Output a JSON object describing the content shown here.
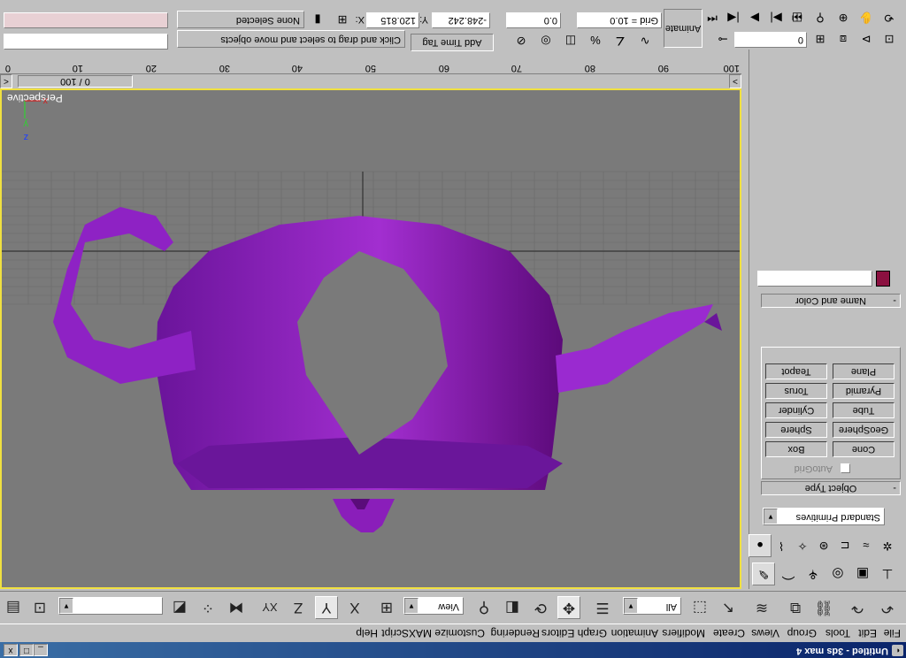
{
  "window": {
    "title": "Untitled - 3ds max 4",
    "minimize": "_",
    "maximize": "□",
    "close": "x"
  },
  "menus": [
    "File",
    "Edit",
    "Tools",
    "Group",
    "Views",
    "Create",
    "Modifiers",
    "Animation",
    "Graph Editors",
    "Rendering",
    "Customize",
    "MAXScript",
    "Help"
  ],
  "toolbar": {
    "selection_filter": "All",
    "ref_coord": "View",
    "axis_x": "X",
    "axis_y": "Y",
    "axis_z": "Z",
    "axis_xy": "XY",
    "active_tool": "select-and-move"
  },
  "command_panel": {
    "category": "Standard Primitives",
    "object_type_title": "Object Type",
    "autogrid_label": "AutoGrid",
    "objects": [
      "Box",
      "Cone",
      "Sphere",
      "GeoSphere",
      "Cylinder",
      "Tube",
      "Torus",
      "Pyramid",
      "Teapot",
      "Plane"
    ],
    "name_color_title": "Name and Color",
    "name_value": "",
    "object_color": "#8b1040"
  },
  "viewport": {
    "label": "Perspective",
    "active_border_color": "#f0e040",
    "object_color": "#9020c0",
    "axis_x": "x",
    "axis_y": "y",
    "axis_z": "z"
  },
  "time_slider": {
    "position": "0 / 100",
    "prev": "<",
    "next": ">"
  },
  "trackbar": {
    "ticks": [
      "0",
      "10",
      "20",
      "30",
      "40",
      "50",
      "60",
      "70",
      "80",
      "90",
      "100"
    ]
  },
  "status": {
    "selection": "None Selected",
    "prompt": "Click and drag to select and move objects",
    "x_label": "X:",
    "x_value": "120.815",
    "y_label": "Y:",
    "y_value": "-248.242",
    "z_label": "Z:",
    "z_value": "0.0",
    "grid": "Grid = 10.0",
    "add_time_tag": "Add Time Tag",
    "animate": "Animate",
    "frame": "0"
  }
}
